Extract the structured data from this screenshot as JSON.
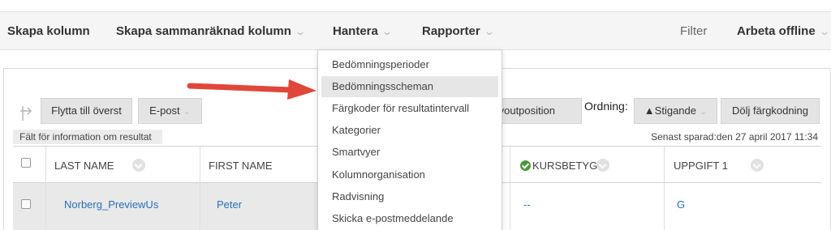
{
  "topbar": {
    "create_column": "Skapa kolumn",
    "create_calculated_column": "Skapa sammanräknad kolumn",
    "manage": "Hantera",
    "reports": "Rapporter",
    "filter": "Filter",
    "work_offline": "Arbeta offline",
    "chevron": "⌄"
  },
  "toolbar": {
    "move_to_top": "Flytta till överst",
    "email": "E-post",
    "layout_position": "voutposition",
    "ordering_label": "Ordning:",
    "ascending": "▲Stigande",
    "hide_color_coding": "Dölj färgkodning"
  },
  "info_field_label": "Fält för information om resultat",
  "last_saved": "Senast sparad:den 27 april 2017 11:34",
  "grid": {
    "columns": [
      "LAST NAME",
      "FIRST NAME",
      "KURSBETYG",
      "UPPGIFT 1"
    ],
    "rows": [
      {
        "last_name": "Norberg_PreviewUs",
        "first_name": "Peter",
        "course_grade": "--",
        "assignment_1": "G"
      }
    ]
  },
  "manage_menu": {
    "items": [
      "Bedömningsperioder",
      "Bedömningsscheman",
      "Färgkoder för resultatintervall",
      "Kategorier",
      "Smartvyer",
      "Kolumnorganisation",
      "Radvisning",
      "Skicka e-postmeddelande"
    ],
    "highlighted_index": 1
  },
  "colors": {
    "link": "#2a6ebb",
    "arrow": "#e0473a",
    "check": "#4a9a3c",
    "highlight": "#e6e6e6"
  },
  "icons": [
    "arrow-into-box-icon",
    "chevron-down-icon",
    "checkmark-circle-icon",
    "sort-circle-icon",
    "red-pointer-arrow-icon"
  ]
}
